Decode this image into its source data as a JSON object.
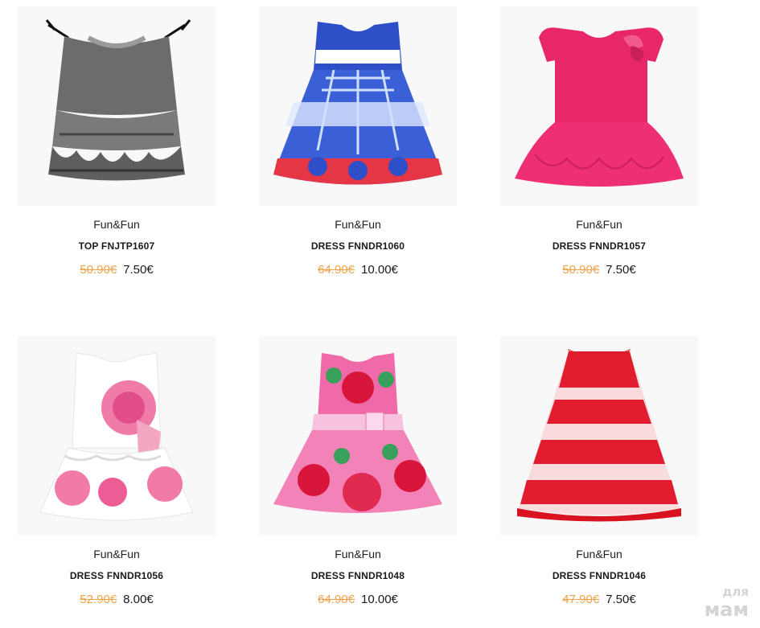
{
  "products": [
    {
      "brand": "Fun&Fun",
      "title": "TOP FNJTP1607",
      "old_price": "50.90€",
      "new_price": "7.50€",
      "image_icon": "gray-ruffle-top-image"
    },
    {
      "brand": "Fun&Fun",
      "title": "DRESS FNNDR1060",
      "old_price": "64.90€",
      "new_price": "10.00€",
      "image_icon": "blue-red-dress-image"
    },
    {
      "brand": "Fun&Fun",
      "title": "DRESS FNNDR1057",
      "old_price": "50.90€",
      "new_price": "7.50€",
      "image_icon": "pink-dress-image"
    },
    {
      "brand": "Fun&Fun",
      "title": "DRESS FNNDR1056",
      "old_price": "52.90€",
      "new_price": "8.00€",
      "image_icon": "white-rose-dress-image"
    },
    {
      "brand": "Fun&Fun",
      "title": "DRESS FNNDR1048",
      "old_price": "64.90€",
      "new_price": "10.00€",
      "image_icon": "pink-floral-dress-image"
    },
    {
      "brand": "Fun&Fun",
      "title": "DRESS FNNDR1046",
      "old_price": "47.90€",
      "new_price": "7.50€",
      "image_icon": "red-lace-dress-image"
    }
  ],
  "watermark": {
    "line1": "для",
    "line2": "мам"
  },
  "colors": {
    "old_price": "#f0a24b",
    "text": "#1a1a1a",
    "thumb_bg": "#f8f8f8"
  }
}
